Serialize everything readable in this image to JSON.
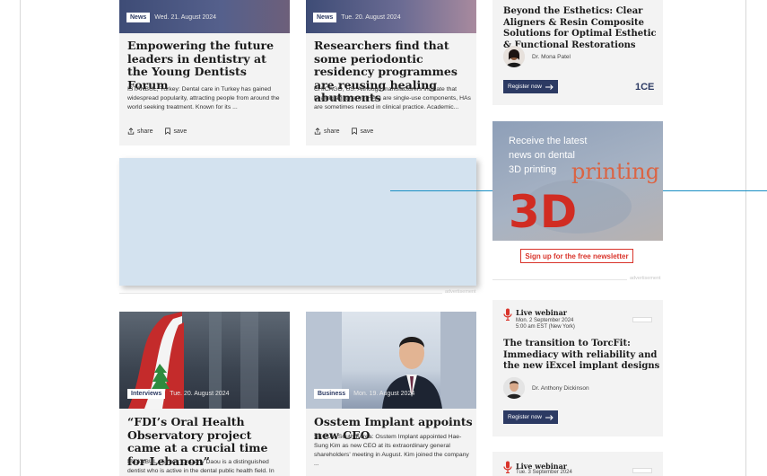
{
  "articles": [
    {
      "category": "News",
      "date": "Wed. 21. August 2024",
      "title": "Empowering the future leaders in dentistry at the Young Dentists Forum",
      "excerpt": "ISTANBUL, Turkey: Dental care in Turkey has gained widespread popularity, attracting people from around the world seeking treatment. Known for its ...",
      "share": "share",
      "save": "save"
    },
    {
      "category": "News",
      "date": "Tue. 20. August 2024",
      "title": "Researchers find that some periodontic residency programmes are reusing healing abutments",
      "excerpt": "CHICAGO, US: Although manufacturers indicate that healing abutments (HAs) are single-use components, HAs are sometimes reused in clinical practice. Academic...",
      "share": "share",
      "save": "save"
    },
    {
      "category": "Interviews",
      "date": "Tue. 20. August 2024",
      "title": "“FDI’s Oral Health Observatory project came at a crucial time for Lebanon”",
      "excerpt": "ISTANBUL, Turkey: Dr Dany Daou is a distinguished dentist who is active in the dental public health field. In"
    },
    {
      "category": "Business",
      "date": "Mon. 19. August 2024",
      "title": "Osstem Implant appoints new CEO",
      "excerpt": "SEOUL, South Korea: Osstem Implant appointed Hae-Sung Kim as new CEO at its extraordinary general shareholders’ meeting in August. Kim joined the company ..."
    }
  ],
  "advertisement_label": "advertisement",
  "sidebar": {
    "course": {
      "title": "Beyond the Esthetics: Clear Aligners & Resin Composite Solutions for Optimal Esthetic & Functional Restorations",
      "author": "Dr. Mona Patel",
      "button": "Register now",
      "badge": "1CE"
    },
    "promo": {
      "text_line1": "Receive the latest",
      "text_line2": "news on dental",
      "text_line3": "3D printing",
      "graphic_word": "printing",
      "graphic_3d": "3D",
      "button": "Sign up for the free newsletter"
    },
    "webinar1": {
      "label": "Live webinar",
      "date": "Mon. 2 September 2024",
      "time": "5:00 am EST (New York)",
      "title": "The transition to TorcFit: Immediacy with reliability and the new iExcel implant designs",
      "author": "Dr. Anthony Dickinson",
      "button": "Register now"
    },
    "webinar2": {
      "label": "Live webinar",
      "date": "Tue. 3 September 2024"
    }
  },
  "colors": {
    "brand_navy": "#2c3a63",
    "accent_red": "#d9342b",
    "ad_slot": "#d3e2ef",
    "card_bg": "#f3f3f3"
  }
}
